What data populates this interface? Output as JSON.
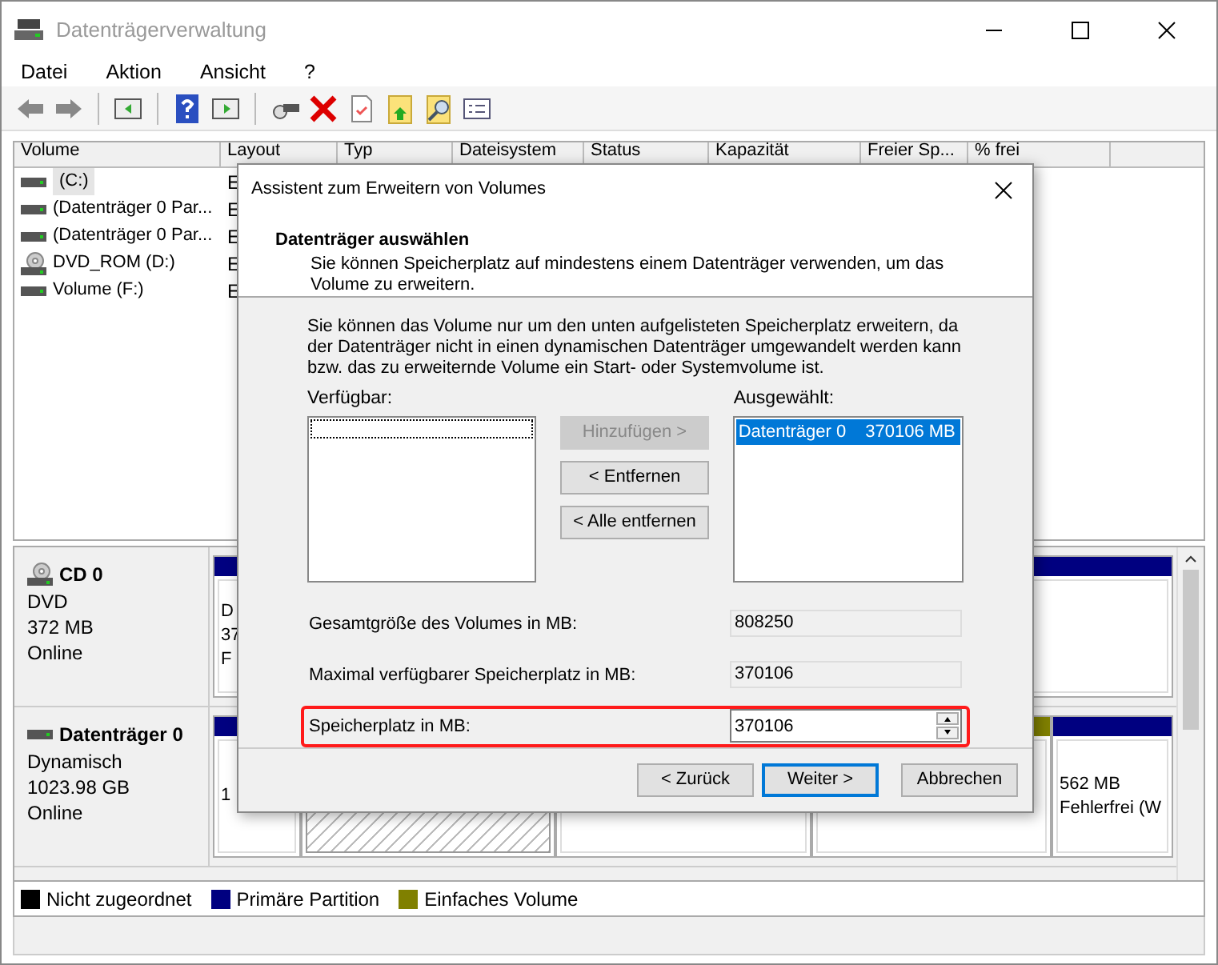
{
  "window": {
    "title": "Datenträgerverwaltung"
  },
  "menu": [
    "Datei",
    "Aktion",
    "Ansicht",
    "?"
  ],
  "volume_table": {
    "columns": [
      "Volume",
      "Layout",
      "Typ",
      "Dateisystem",
      "Status",
      "Kapazität",
      "Freier Sp...",
      "% frei"
    ],
    "rows": [
      {
        "volume": "(C:)",
        "kind": "disk",
        "layout": "E",
        "selected": true
      },
      {
        "volume": "(Datenträger 0 Par...",
        "kind": "disk",
        "layout": "E",
        "selected": false
      },
      {
        "volume": "(Datenträger 0 Par...",
        "kind": "disk",
        "layout": "E",
        "selected": false
      },
      {
        "volume": "DVD_ROM (D:)",
        "kind": "dvd",
        "layout": "E",
        "selected": false
      },
      {
        "volume": "Volume (F:)",
        "kind": "disk",
        "layout": "E",
        "selected": false
      }
    ]
  },
  "disks": [
    {
      "name": "CD 0",
      "kind": "dvd",
      "lines": [
        "DVD",
        "372 MB",
        "Online"
      ],
      "partitions": [
        {
          "color": "#000080",
          "selected": false,
          "texts": [
            "D",
            "37",
            "F"
          ]
        }
      ]
    },
    {
      "name": "Datenträger 0",
      "kind": "disk",
      "lines": [
        "Dynamisch",
        "1023.98 GB",
        "Online"
      ],
      "partitions": [
        {
          "color": "#000080",
          "selected": false,
          "texts": [
            "1"
          ]
        },
        {
          "selected": true
        },
        {
          "selected": false
        },
        {
          "color": "#808000",
          "selected": false
        },
        {
          "color": "#000080",
          "selected": false,
          "texts": [
            "562 MB",
            "Fehlerfrei (W"
          ]
        }
      ]
    }
  ],
  "legend": [
    {
      "label": "Nicht zugeordnet",
      "color": "#000000"
    },
    {
      "label": "Primäre Partition",
      "color": "#000080"
    },
    {
      "label": "Einfaches Volume",
      "color": "#808000"
    }
  ],
  "dialog": {
    "title": "Assistent zum Erweitern von Volumes",
    "heading": "Datenträger auswählen",
    "subtitle": "Sie können Speicherplatz auf mindestens einem Datenträger verwenden, um das Volume zu erweitern.",
    "description": "Sie können das Volume nur um den unten aufgelisteten Speicherplatz erweitern, da der Datenträger nicht in einen dynamischen Datenträger umgewandelt werden kann bzw. das zu erweiternde Volume ein Start- oder Systemvolume ist.",
    "available_label": "Verfügbar:",
    "selected_label": "Ausgewählt:",
    "move_buttons": [
      {
        "label": "Hinzufügen >",
        "disabled": true
      },
      {
        "label": "< Entfernen",
        "disabled": false
      },
      {
        "label": "< Alle entfernen",
        "disabled": false
      }
    ],
    "selected_items": [
      {
        "disk": "Datenträger 0",
        "size": "370106 MB",
        "selected": true
      }
    ],
    "fields": [
      {
        "label": "Gesamtgröße des Volumes in MB:",
        "value": "808250",
        "kind": "readonly",
        "highlighted": false
      },
      {
        "label": "Maximal verfügbarer Speicherplatz in MB:",
        "value": "370106",
        "kind": "readonly",
        "highlighted": false
      },
      {
        "label": "Speicherplatz in MB:",
        "value": "370106",
        "kind": "spin",
        "highlighted": true
      }
    ],
    "buttons": [
      {
        "label": "< Zurück",
        "default": false
      },
      {
        "label": "Weiter >",
        "default": true
      },
      {
        "label": "Abbrechen",
        "default": false
      }
    ]
  }
}
